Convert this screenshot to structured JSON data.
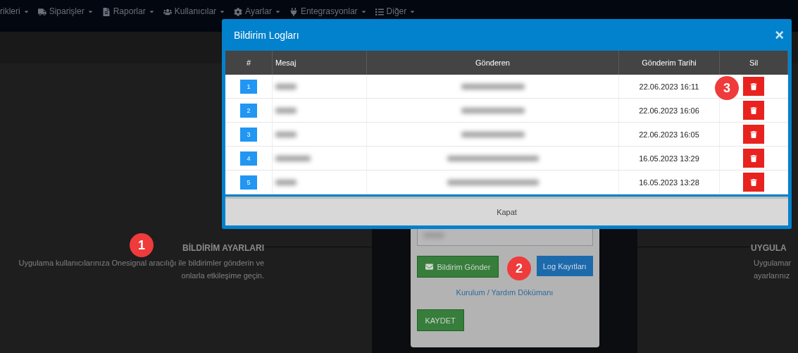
{
  "nav": [
    {
      "label": "rikleri"
    },
    {
      "label": "Siparişler"
    },
    {
      "label": "Raporlar"
    },
    {
      "label": "Kullanıcılar"
    },
    {
      "label": "Ayarlar"
    },
    {
      "label": "Entegrasyonlar"
    },
    {
      "label": "Diğer"
    }
  ],
  "left_section": {
    "title": "BİLDİRİM AYARLARI",
    "text": "Uygulama kullanıcılarınıza Onesignal aracılığı ile bildirimler gönderin ve onlarla etkileşime geçin."
  },
  "right_section": {
    "title": "UYGULA",
    "lines": [
      "Uygulamar",
      "ayarlarınız"
    ]
  },
  "form": {
    "send_button": "Bildirim Gönder",
    "log_button": "Log Kayıtları",
    "help_link": "Kurulum / Yardım Dökümanı",
    "save_button": "KAYDET"
  },
  "modal": {
    "title": "Bildirim Logları",
    "close": "×",
    "columns": [
      "#",
      "Mesaj",
      "Gönderen",
      "Gönderim Tarihi",
      "Sil"
    ],
    "rows": [
      {
        "index": "1",
        "date": "22.06.2023 16:11"
      },
      {
        "index": "2",
        "date": "22.06.2023 16:06"
      },
      {
        "index": "3",
        "date": "22.06.2023 16:05"
      },
      {
        "index": "4",
        "date": "16.05.2023 13:29"
      },
      {
        "index": "5",
        "date": "16.05.2023 13:28"
      }
    ],
    "footer_button": "Kapat"
  },
  "markers": [
    {
      "label": "1"
    },
    {
      "label": "2"
    },
    {
      "label": "3"
    }
  ]
}
